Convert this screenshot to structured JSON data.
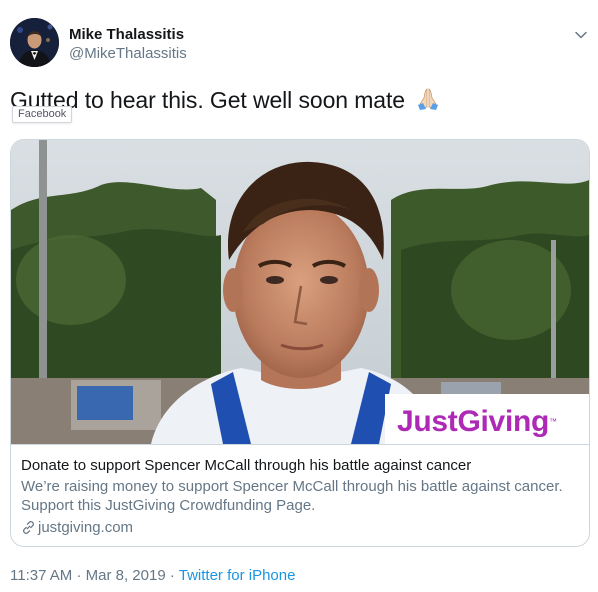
{
  "author": {
    "display_name": "Mike Thalassitis",
    "handle": "@MikeThalassitis"
  },
  "tweet": {
    "text": "Gutted to hear this. Get well soon mate",
    "emoji_icon": "folded-hands-icon",
    "tooltip": "Facebook"
  },
  "card": {
    "brand": "JustGiving",
    "brand_tm": "™",
    "title": "Donate to support Spencer McCall through his battle against cancer",
    "description": "We’re raising money to support Spencer McCall through his battle against cancer. Support this JustGiving Crowdfunding Page.",
    "domain": "justgiving.com",
    "link_icon": "link-icon"
  },
  "meta": {
    "time": "11:37 AM",
    "separator": "·",
    "date": "Mar 8, 2019",
    "source": "Twitter for iPhone"
  },
  "colors": {
    "link": "#1b95e0",
    "secondary": "#657786",
    "brand": "#ad29b6"
  }
}
